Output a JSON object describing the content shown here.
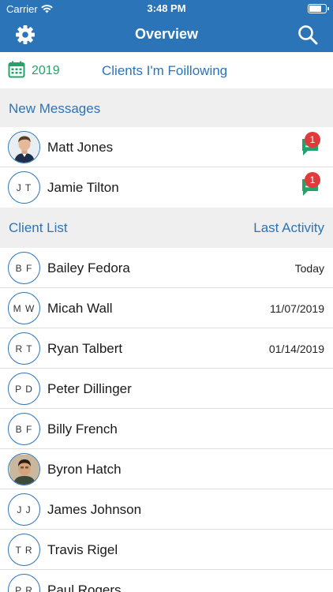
{
  "status_bar": {
    "carrier": "Carrier",
    "time": "3:48 PM"
  },
  "nav": {
    "title": "Overview",
    "left_icon": "gear-icon",
    "right_icon": "search-icon"
  },
  "filter": {
    "year": "2019",
    "following_label": "Clients I'm Foillowing",
    "calendar_icon": "calendar-icon"
  },
  "messages_section": {
    "title": "New Messages",
    "items": [
      {
        "name": "Matt Jones",
        "initials": "",
        "has_photo": true,
        "badge": "1"
      },
      {
        "name": "Jamie Tilton",
        "initials": "J T",
        "has_photo": false,
        "badge": "1"
      }
    ]
  },
  "clients_section": {
    "title": "Client List",
    "right_label": "Last Activity",
    "items": [
      {
        "name": "Bailey Fedora",
        "initials": "B F",
        "date": "Today"
      },
      {
        "name": "Micah Wall",
        "initials": "M W",
        "date": "11/07/2019"
      },
      {
        "name": "Ryan Talbert",
        "initials": "R T",
        "date": "01/14/2019"
      },
      {
        "name": "Peter Dillinger",
        "initials": "P D",
        "date": ""
      },
      {
        "name": "Billy French",
        "initials": "B F",
        "date": ""
      },
      {
        "name": "Byron Hatch",
        "initials": "",
        "date": ""
      },
      {
        "name": "James Johnson",
        "initials": "J J",
        "date": ""
      },
      {
        "name": "Travis Rigel",
        "initials": "T R",
        "date": ""
      },
      {
        "name": "Paul Rogers",
        "initials": "P R",
        "date": ""
      }
    ]
  },
  "colors": {
    "brand": "#2b74b8",
    "accent_green": "#23a36a",
    "badge_red": "#e03a3a"
  }
}
